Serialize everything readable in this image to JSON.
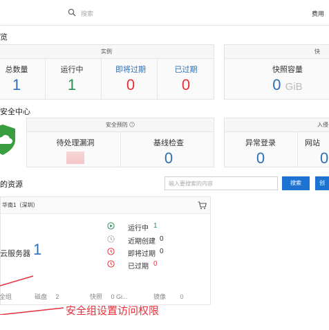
{
  "topbar": {
    "search_placeholder": "搜索",
    "fee_label": "费用"
  },
  "overview": {
    "title": "览",
    "instances": {
      "header": "实例",
      "stats": [
        {
          "label": "总数量",
          "value": "1"
        },
        {
          "label": "运行中",
          "value": "1"
        },
        {
          "label": "即将过期",
          "value": "0"
        },
        {
          "label": "已过期",
          "value": "0"
        }
      ]
    },
    "snapshots": {
      "header": "快",
      "label": "快照容量",
      "value": "0",
      "unit": "GiB"
    }
  },
  "security": {
    "title": "安全中心",
    "warning": {
      "header": "安全预防",
      "items": [
        {
          "label": "待处理漏洞",
          "value": ""
        },
        {
          "label": "基线检查",
          "value": "0"
        }
      ]
    },
    "intrusion": {
      "header": "入侵",
      "items": [
        {
          "label": "异常登录",
          "value": "0"
        },
        {
          "label": "网站",
          "value": "0"
        }
      ]
    }
  },
  "resources": {
    "title": "的资源",
    "search_placeholder": "输入要搜索的内容",
    "search_button": "搜索",
    "more_button": "创",
    "card": {
      "region": "华南1（深圳）",
      "service_label": "云服务器",
      "count": "1",
      "statuses": [
        {
          "label": "运行中",
          "value": "1"
        },
        {
          "label": "近期创建",
          "value": "0"
        },
        {
          "label": "即将过期",
          "value": "0"
        },
        {
          "label": "已过期",
          "value": "0"
        }
      ],
      "footer": [
        {
          "label": "安全组",
          "value": ""
        },
        {
          "label": "磁盘",
          "value": "2"
        },
        {
          "label": "快照",
          "value": "0 Gi..."
        },
        {
          "label": "镜像",
          "value": "0"
        }
      ]
    }
  },
  "annotation": "安全组设置访问权限",
  "colors": {
    "accent_blue": "#1e73d2",
    "value_blue": "#2f6fb3",
    "running_green": "#2e8b57",
    "danger_red": "#e5303a",
    "shield_green": "#3a9d3f"
  }
}
